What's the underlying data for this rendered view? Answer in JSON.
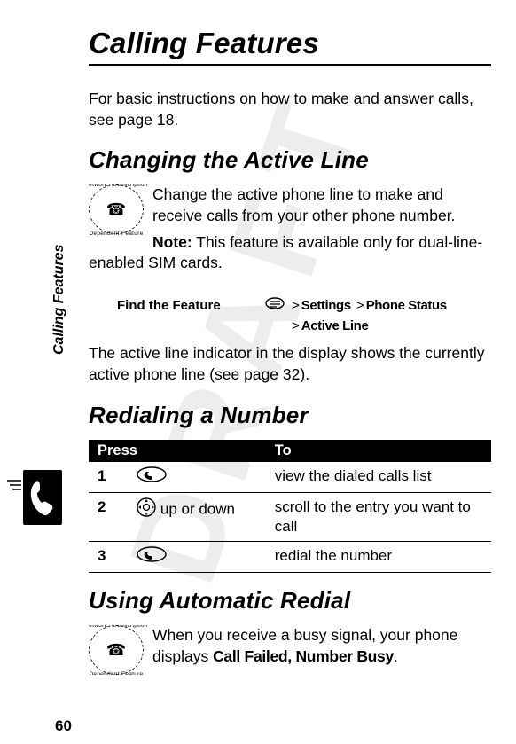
{
  "watermark_text": "DRAFT",
  "side_label": "Calling Features",
  "page_number": "60",
  "chapter_title": "Calling Features",
  "intro": "For basic instructions on how to make and answer calls, see page 18.",
  "section1": {
    "title": "Changing the Active Line",
    "para1": "Change the active phone line to make and receive calls from your other phone number.",
    "note_label": "Note:",
    "note_text": " This feature is available only for dual-line-enabled SIM cards.",
    "find_label": "Find the Feature",
    "menu_sep": ">",
    "menu1": "Settings",
    "menu2": "Phone Status",
    "menu3": "Active Line",
    "para2": "The active line indicator in the display shows the currently active phone line (see page 32)."
  },
  "section2": {
    "title": "Redialing a Number",
    "headers": {
      "press": "Press",
      "to": "To"
    },
    "rows": [
      {
        "step": "1",
        "key": "send-key",
        "key_text": "",
        "result": "view the dialed calls list"
      },
      {
        "step": "2",
        "key": "nav-key",
        "key_text": " up or down",
        "result": "scroll to the entry you want to call"
      },
      {
        "step": "3",
        "key": "send-key",
        "key_text": "",
        "result": "redial the number"
      }
    ]
  },
  "section3": {
    "title": "Using Automatic Redial",
    "para_pre": "When you receive a busy signal, your phone displays ",
    "display_text": "Call Failed, Number Busy",
    "para_post": "."
  },
  "icons": {
    "stamp_top": "Network / Subscription",
    "stamp_bottom": "Dependent Feature"
  }
}
